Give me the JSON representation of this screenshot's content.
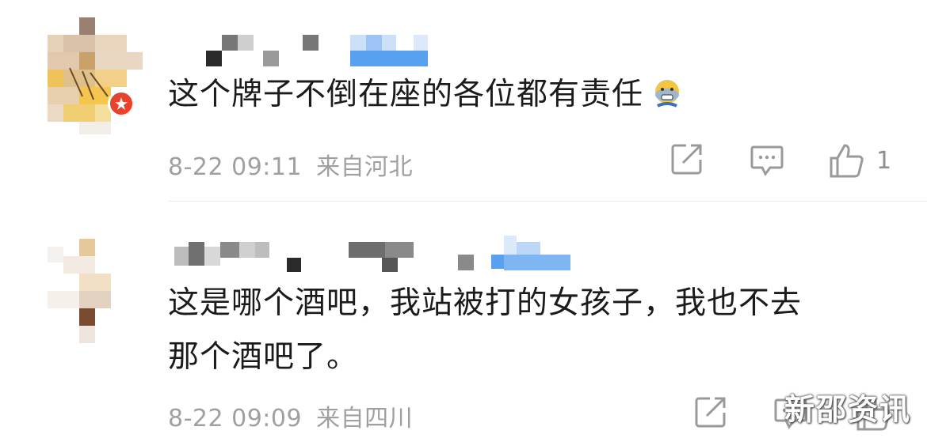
{
  "comments": [
    {
      "text": "这个牌子不倒在座的各位都有责任",
      "time": "8-22 09:11",
      "location": "来自河北",
      "likes": "1",
      "emoji": "scared-face-emoji"
    },
    {
      "text": "这是哪个酒吧，我站被打的女孩子，我也不去\n那个酒吧了。",
      "time": "8-22 09:09",
      "location": "来自四川",
      "likes": ""
    }
  ],
  "icons": {
    "share": "share-icon",
    "reply": "comment-icon",
    "like": "thumbs-up-icon",
    "badge": "verified-badge-icon"
  },
  "colors": {
    "badge": "#e8422d",
    "meta_text": "#a0a0a0",
    "name_mosaic_blue": "#5aa0f0"
  },
  "watermark": "新邵资讯"
}
